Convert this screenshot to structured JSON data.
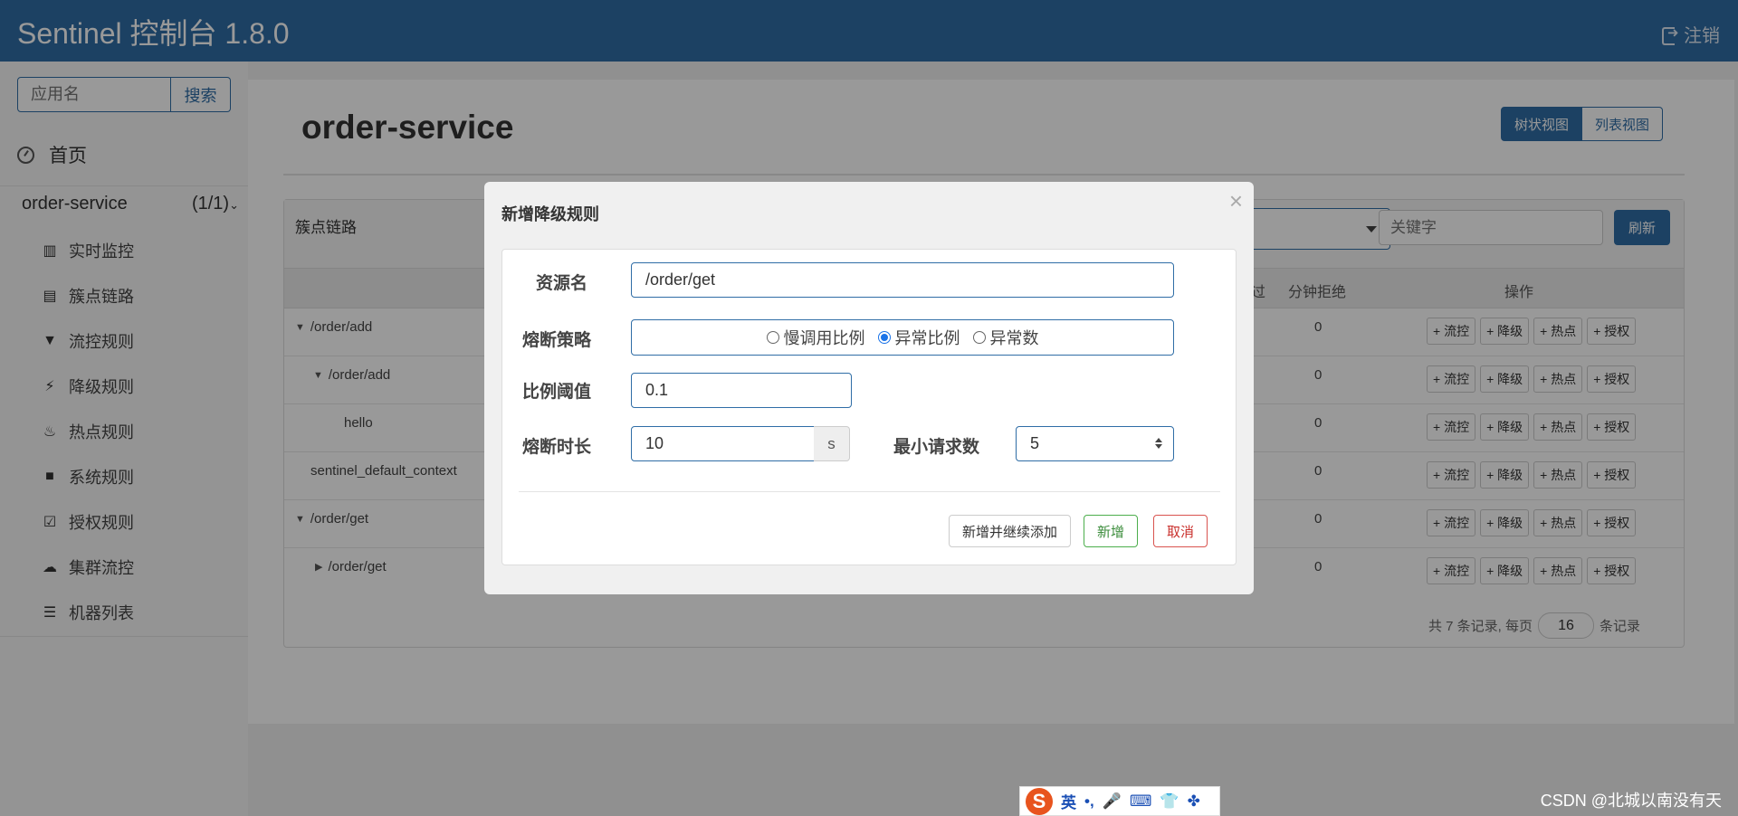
{
  "header": {
    "brand": "Sentinel 控制台 1.8.0",
    "logout_label": "注销",
    "logout_icon": "sign-out-icon"
  },
  "sidebar": {
    "search_placeholder": "应用名",
    "search_button": "搜索",
    "home_label": "首页",
    "app": {
      "name": "order-service",
      "count": "(1/1)"
    },
    "items": [
      {
        "label": "实时监控",
        "icon": "bar-chart-icon"
      },
      {
        "label": "簇点链路",
        "icon": "list-icon"
      },
      {
        "label": "流控规则",
        "icon": "filter-icon"
      },
      {
        "label": "降级规则",
        "icon": "flash-icon"
      },
      {
        "label": "热点规则",
        "icon": "fire-icon"
      },
      {
        "label": "系统规则",
        "icon": "lock-icon"
      },
      {
        "label": "授权规则",
        "icon": "check-square-icon"
      },
      {
        "label": "集群流控",
        "icon": "cloud-icon"
      },
      {
        "label": "机器列表",
        "icon": "th-list-icon"
      }
    ]
  },
  "main": {
    "title": "order-service",
    "view_tree": "树状视图",
    "view_list": "列表视图",
    "panel_title": "簇点链路",
    "keyword_placeholder": "关键字",
    "refresh": "刷新",
    "headers": {
      "pass_tail": "过",
      "min_reject": "分钟拒绝",
      "ops": "操作"
    },
    "rows": [
      {
        "name": "/order/add",
        "value": "0"
      },
      {
        "name": "/order/add",
        "value": "0"
      },
      {
        "name": "hello",
        "value": "0"
      },
      {
        "name": "sentinel_default_context",
        "value": "0"
      },
      {
        "name": "/order/get",
        "value": "0"
      },
      {
        "name": "/order/get",
        "value": "0"
      }
    ],
    "ops": {
      "flow": "+ 流控",
      "degrade": "+ 降级",
      "hot": "+ 热点",
      "auth": "+ 授权"
    },
    "pager": {
      "prefix": "共 7 条记录, 每页",
      "page_size": "16",
      "suffix": "条记录"
    }
  },
  "modal": {
    "title": "新增降级规则",
    "close": "×",
    "resource_label": "资源名",
    "resource_value": "/order/get",
    "strategy_label": "熔断策略",
    "strategy_options": [
      "慢调用比例",
      "异常比例",
      "异常数"
    ],
    "strategy_selected": "异常比例",
    "ratio_label": "比例阈值",
    "ratio_value": "0.1",
    "duration_label": "熔断时长",
    "duration_value": "10",
    "duration_unit": "s",
    "min_req_label": "最小请求数",
    "min_req_value": "5",
    "btn_continue": "新增并继续添加",
    "btn_add": "新增",
    "btn_cancel": "取消"
  },
  "ime": {
    "logo": "S",
    "lang": "英",
    "punct": "•,",
    "items": [
      "mic-icon",
      "keyboard-icon",
      "shirt-icon",
      "grid-icon"
    ]
  },
  "watermark": "CSDN @北城以南没有天"
}
